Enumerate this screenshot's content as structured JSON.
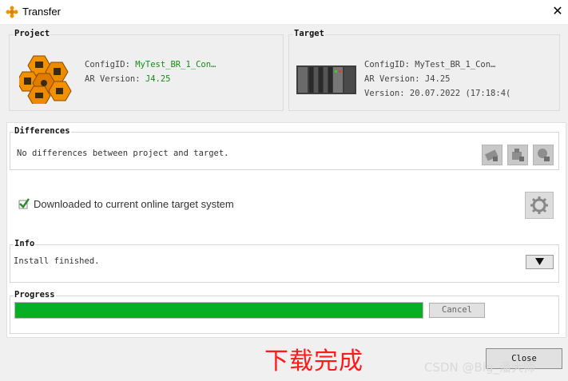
{
  "window": {
    "title": "Transfer",
    "close_glyph": "✕"
  },
  "project": {
    "group_title": "Project",
    "config_label": "ConfigID:",
    "config_value": "MyTest_BR_1_Con…",
    "ar_label": "AR Version:",
    "ar_value": "J4.25",
    "logo_icon": "project-logo-icon"
  },
  "target": {
    "group_title": "Target",
    "config_label": "ConfigID:",
    "config_value": "MyTest_BR_1_Con…",
    "ar_label": "AR Version:",
    "ar_value": "J4.25",
    "version_label": "Version:",
    "version_value": "20.07.2022 (17:18:4(",
    "device_icon": "plc-device-icon"
  },
  "differences": {
    "group_title": "Differences",
    "message": "No differences between project and target.",
    "buttons": [
      "compare-icon",
      "download-icon",
      "upload-icon"
    ]
  },
  "status": {
    "text": "Downloaded to current online target system",
    "check_color": "#2e8b2e"
  },
  "info": {
    "group_title": "Info",
    "message": "Install finished."
  },
  "progress": {
    "group_title": "Progress",
    "fraction": 1.0,
    "fill_color": "#06b025",
    "cancel_label": "Cancel"
  },
  "footer": {
    "close_label": "Close",
    "overlay_text": "下载完成",
    "watermark": "CSDN @Big_潘大师"
  }
}
